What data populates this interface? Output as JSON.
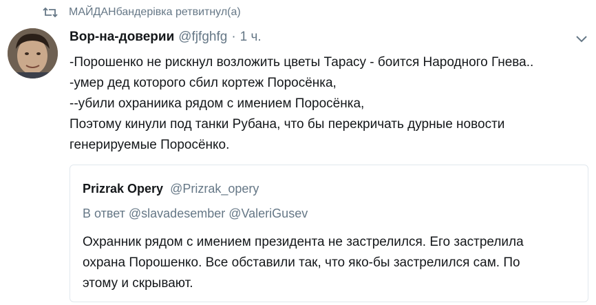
{
  "retweet": {
    "icon": "retweet-icon",
    "text": "МАЙДАНбандерівка ретвитнул(а)"
  },
  "tweet": {
    "avatar_icon": "user-avatar",
    "author_name": "Вор-на-доверии",
    "author_handle": "@fjfghfg",
    "separator": "·",
    "time": "1 ч.",
    "menu_icon": "chevron-down-icon",
    "lines": [
      "-Порошенко не рискнул возложить цветы Тарасу - боится Народного Гнева..",
      "-умер дед которого сбил кортеж Поросёнка,",
      "--убили охраниика рядом с имением Поросёнка,",
      "Поэтому кинули под танки Рубана, что бы перекричать дурные новости",
      "генерируемые Поросёнко."
    ]
  },
  "quoted_tweet": {
    "author_name": "Prizrak Opery",
    "author_handle": "@Prizrak_opery",
    "reply_to": "В ответ @slavadesember @ValeriGusev",
    "lines": [
      "Охранник рядом с имением президента не застрелился. Его застрелила",
      "охрана Порошенко. Все обставили так, что яко-бы застрелился сам. По",
      "этому и скрывают."
    ]
  },
  "colors": {
    "text": "#14171a",
    "muted": "#657786",
    "border": "#e1e8ed",
    "background": "#ffffff"
  }
}
